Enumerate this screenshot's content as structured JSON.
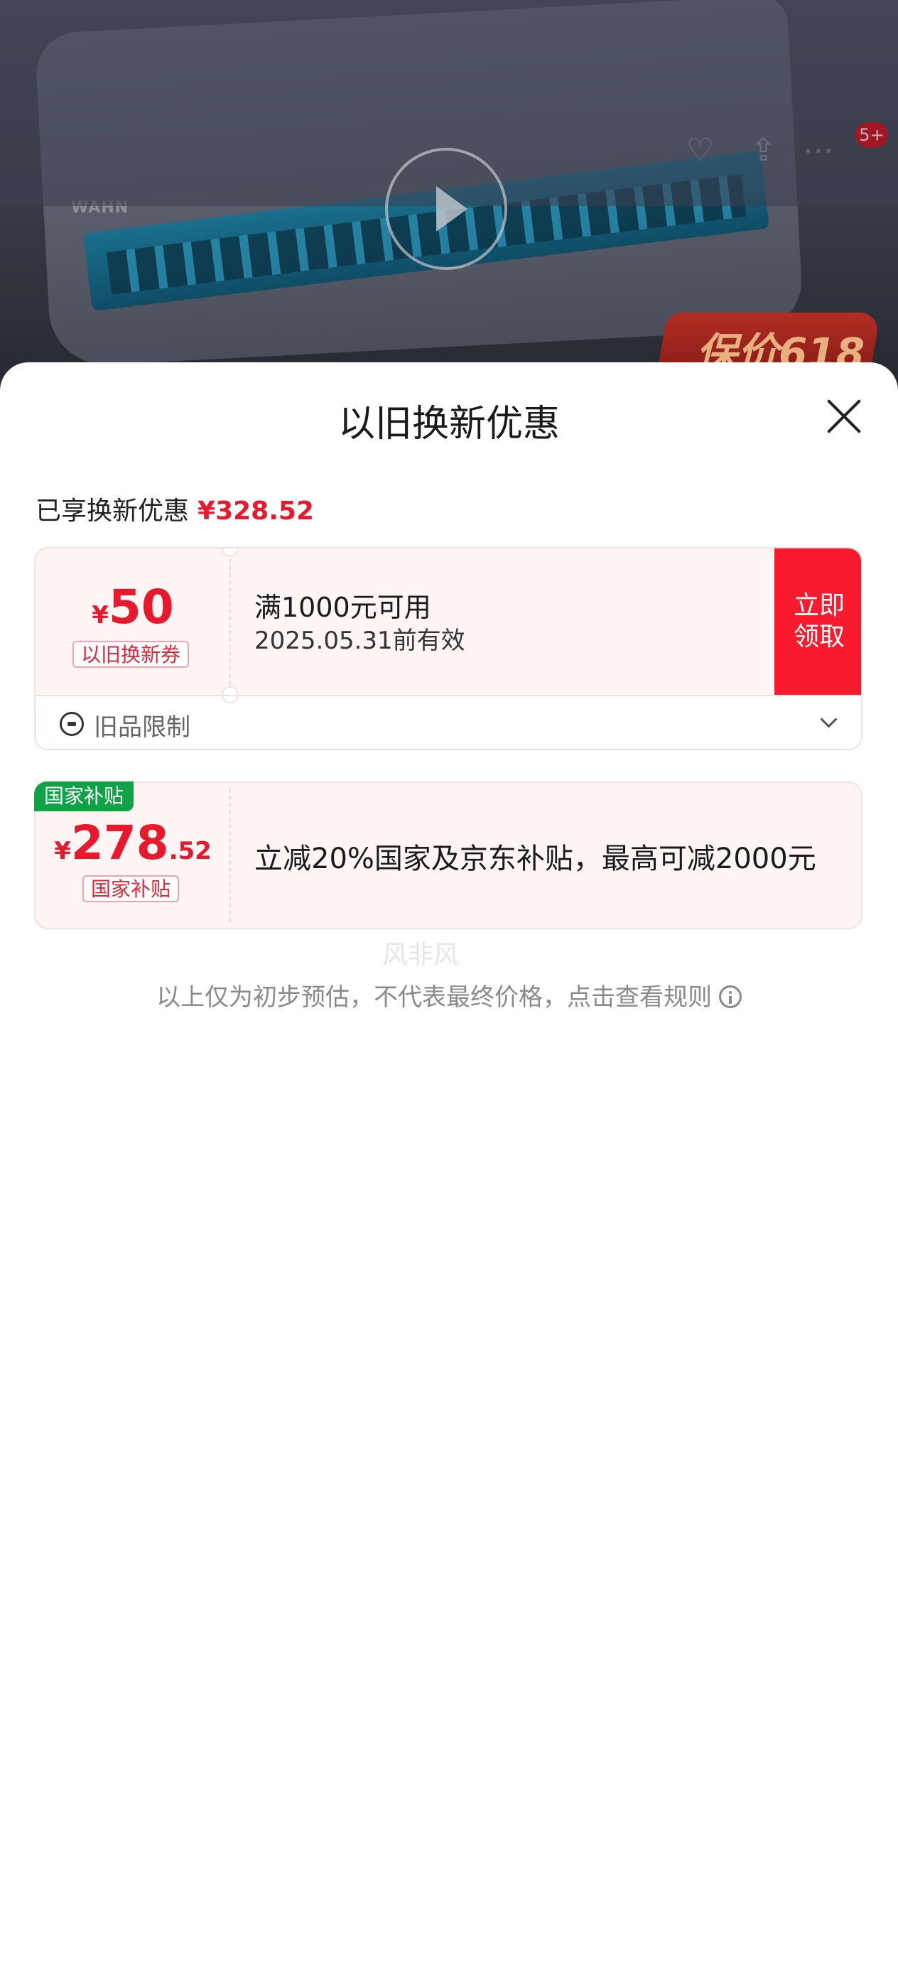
{
  "backdrop": {
    "brand_text": "WAHN",
    "notification_count": "5+",
    "promo_text": "保价618"
  },
  "sheet": {
    "title": "以旧换新优惠",
    "summary_label": "已享换新优惠",
    "summary_amount": "¥328.52"
  },
  "coupon": {
    "currency": "¥",
    "value": "50",
    "type_tag": "以旧换新券",
    "condition": "满1000元可用",
    "validity": "2025.05.31前有效",
    "claim_line1": "立即",
    "claim_line2": "领取",
    "restriction_label": "旧品限制"
  },
  "subsidy": {
    "flag": "国家补贴",
    "currency": "¥",
    "value_int": "278",
    "value_dec": ".52",
    "type_tag": "国家补贴",
    "description": "立减20%国家及京东补贴，最高可减2000元"
  },
  "watermark": "风非风",
  "footnote": "以上仅为初步预估，不代表最终价格，点击查看规则",
  "colors": {
    "accent_red": "#e8192c",
    "claim_button": "#fa1a2e",
    "subsidy_green": "#0fa246",
    "card_bg": "#fff5f5"
  },
  "icons": [
    "play-icon",
    "close-icon",
    "old-item-icon",
    "chevron-down-icon",
    "info-icon"
  ]
}
